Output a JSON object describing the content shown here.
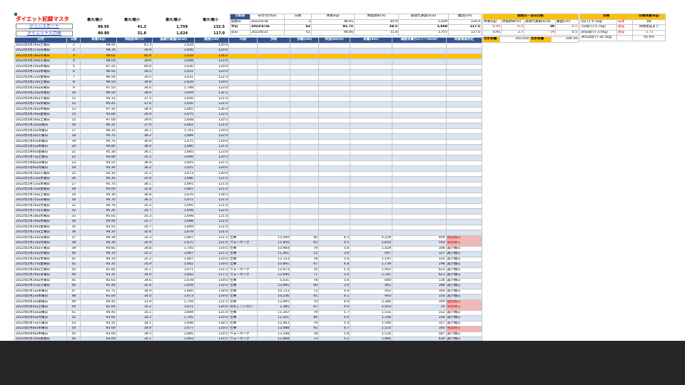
{
  "app": {
    "title": "ダイエット記録マスタ"
  },
  "nav": {
    "dashboard": "ダッシュボード",
    "input": "ダイエット入力表"
  },
  "top_headers": {
    "h1": "最大/最小",
    "h2": "最大/最小",
    "h3": "最大/最小",
    "h4": "最大/最小"
  },
  "summary_rows": [
    {
      "a": "98.95",
      "b": "41.3",
      "c": "1,759",
      "d": "132.5"
    },
    {
      "a": "90.80",
      "b": "31.8",
      "c": "1,624",
      "d": "117.0"
    }
  ],
  "compare": {
    "title": "比較表",
    "headers": [
      "日付(年月日)",
      "日数",
      "体重(kg)",
      "体脂肪率(%)",
      "基礎代謝量(kcal)",
      "腹囲(cm)"
    ],
    "rows": [
      {
        "label": "開始日",
        "date": "2022/4/18",
        "days": "3",
        "w": "98.65",
        "f": "40.9",
        "b": "1,629",
        "g": "124.0"
      },
      {
        "label": "今日",
        "date": "2022/6/16",
        "days": "62",
        "w": "91.75",
        "f": "34.5",
        "b": "1,668",
        "g": "117.5"
      },
      {
        "label": "前日",
        "date": "2022/6/15",
        "days": "61",
        "w": "90.80",
        "f": "31.8",
        "b": "1,707",
        "g": "117.0"
      }
    ]
  },
  "change": {
    "title": "開始日・前日比較",
    "headers": [
      "体重(kg)",
      "体脂肪率(%)",
      "基礎代謝量(kcal)",
      "腹囲(cm)"
    ],
    "rows": [
      [
        "-6.90",
        "-6.4",
        "39",
        "-6.5"
      ],
      [
        "0.95",
        "2.7",
        "-39",
        "0.5"
      ]
    ]
  },
  "goals": {
    "title": "目標",
    "status_title": "目標体重(kg)",
    "rows": [
      {
        "goal": "1日で[-0.1kg]",
        "status": "未達",
        "val": "88"
      },
      {
        "goal": "7日間で[-0.7kg]",
        "status": "達成",
        "val": "目標達成まで"
      },
      {
        "goal": "30日間で[-3.0kg]",
        "status": "達成",
        "val": "-3.75"
      },
      {
        "goal": "365日間で[-36.5kg]",
        "status": "",
        "val": "95.9%"
      }
    ]
  },
  "totals": {
    "label1": "合計距離",
    "v1": "292,058",
    "label2": "合計距離",
    "v2": "206.59"
  },
  "table": {
    "headers": [
      "日付",
      "日数",
      "体重(kg)",
      "体脂肪率(%)",
      "基礎代謝量(kcal)",
      "腹囲(cm)",
      "内容",
      "歩数",
      "歩幅(cm)",
      "時速(km/h)",
      "距離(km)",
      "運動消費カロリー(kcal)",
      "体重増減判定"
    ],
    "rows": [
      [
        "2022年4月16日土曜日",
        "1",
        "98.95",
        "41.3",
        "1,624",
        "120.0",
        "",
        "",
        "",
        "",
        "",
        "",
        ""
      ],
      [
        "2022年4月17日日曜日",
        "2",
        "98.35",
        "39.9",
        "1,646",
        "120.0",
        "",
        "",
        "",
        "",
        "",
        "",
        ""
      ],
      [
        "2022年4月18日月曜日",
        "3",
        "98.65",
        "40.9",
        "1,629",
        "124.0",
        "",
        "",
        "",
        "",
        "",
        "",
        ""
      ],
      [
        "2022年4月19日火曜日",
        "4",
        "98.00",
        "39.6",
        "1,648",
        "123.0",
        "",
        "",
        "",
        "",
        "",
        "",
        ""
      ],
      [
        "2022年4月20日水曜日",
        "5",
        "97.25",
        "40.0",
        "1,630",
        "120.0",
        "",
        "",
        "",
        "",
        "",
        "",
        ""
      ],
      [
        "2022年4月21日木曜日",
        "6",
        "96.50",
        "39.5",
        "1,631",
        "123.0",
        "",
        "",
        "",
        "",
        "",
        "",
        ""
      ],
      [
        "2022年4月22日金曜日",
        "7",
        "96.50",
        "39.5",
        "1,631",
        "122.5",
        "",
        "",
        "",
        "",
        "",
        "",
        ""
      ],
      [
        "2022年4月23日土曜日",
        "8",
        "96.50",
        "39.8",
        "1,628",
        "119.0",
        "",
        "",
        "",
        "",
        "",
        "",
        ""
      ],
      [
        "2022年4月24日日曜日",
        "9",
        "97.55",
        "34.6",
        "1,748",
        "123.0",
        "",
        "",
        "",
        "",
        "",
        "",
        ""
      ],
      [
        "2022年4月25日月曜日",
        "10",
        "96.50",
        "38.6",
        "1,649",
        "132.5",
        "",
        "",
        "",
        "",
        "",
        "",
        ""
      ],
      [
        "2022年4月26日火曜日",
        "11",
        "95.15",
        "37.5",
        "1,656",
        "121.0",
        "",
        "",
        "",
        "",
        "",
        "",
        ""
      ],
      [
        "2022年4月27日水曜日",
        "12",
        "95.45",
        "37.6",
        "1,656",
        "121.0",
        "",
        "",
        "",
        "",
        "",
        "",
        ""
      ],
      [
        "2022年4月28日木曜日",
        "13",
        "97.35",
        "38.4",
        "1,665",
        "126.0",
        "",
        "",
        "",
        "",
        "",
        "",
        ""
      ],
      [
        "2022年4月29日金曜日",
        "14",
        "95.80",
        "36.9",
        "1,675",
        "122.0",
        "",
        "",
        "",
        "",
        "",
        "",
        ""
      ],
      [
        "2022年4月30日土曜日",
        "15",
        "97.00",
        "39.0",
        "1,648",
        "120.5",
        "",
        "",
        "",
        "",
        "",
        "",
        ""
      ],
      [
        "2022年5月1日日曜日",
        "16",
        "96.35",
        "37.9",
        "1,662",
        "121.0",
        "",
        "",
        "",
        "",
        "",
        "",
        ""
      ],
      [
        "2022年5月2日月曜日",
        "17",
        "96.35",
        "34.1",
        "1,741",
        "119.0",
        "",
        "",
        "",
        "",
        "",
        "",
        ""
      ],
      [
        "2022年5月3日火曜日",
        "18",
        "95.75",
        "36.2",
        "1,689",
        "122.0",
        "",
        "",
        "",
        "",
        "",
        "",
        ""
      ],
      [
        "2022年5月4日水曜日",
        "19",
        "95.75",
        "36.9",
        "1,675",
        "119.0",
        "",
        "",
        "",
        "",
        "",
        "",
        ""
      ],
      [
        "2022年5月5日木曜日",
        "20",
        "94.80",
        "36.0",
        "1,680",
        "121.0",
        "",
        "",
        "",
        "",
        "",
        "",
        ""
      ],
      [
        "2022年5月6日金曜日",
        "21",
        "95.30",
        "36.1",
        "1,685",
        "123.0",
        "",
        "",
        "",
        "",
        "",
        "",
        ""
      ],
      [
        "2022年5月7日土曜日",
        "22",
        "94.80",
        "35.5",
        "1,690",
        "120.5",
        "",
        "",
        "",
        "",
        "",
        "",
        ""
      ],
      [
        "2022年5月8日日曜日",
        "23",
        "93.55",
        "36.9",
        "1,645",
        "121.5",
        "",
        "",
        "",
        "",
        "",
        "",
        ""
      ],
      [
        "2022年5月9日月曜日",
        "24",
        "93.30",
        "36.2",
        "1,655",
        "120.0",
        "",
        "",
        "",
        "",
        "",
        "",
        ""
      ],
      [
        "2022年5月10日火曜日",
        "25",
        "93.10",
        "35.2",
        "1,673",
        "120.0",
        "",
        "",
        "",
        "",
        "",
        "",
        ""
      ],
      [
        "2022年5月11日水曜日",
        "26",
        "94.35",
        "35.4",
        "1,686",
        "121.0",
        "",
        "",
        "",
        "",
        "",
        "",
        ""
      ],
      [
        "2022年5月12日木曜日",
        "27",
        "95.75",
        "36.1",
        "1,691",
        "121.0",
        "",
        "",
        "",
        "",
        "",
        "",
        ""
      ],
      [
        "2022年5月13日金曜日",
        "28",
        "95.00",
        "35.8",
        "1,687",
        "121.0",
        "",
        "",
        "",
        "",
        "",
        "",
        ""
      ],
      [
        "2022年5月14日土曜日",
        "29",
        "95.30",
        "36.8",
        "1,670",
        "118.5",
        "",
        "",
        "",
        "",
        "",
        "",
        ""
      ],
      [
        "2022年5月15日日曜日",
        "30",
        "94.70",
        "36.3",
        "1,672",
        "121.0",
        "",
        "",
        "",
        "",
        "",
        "",
        ""
      ],
      [
        "2022年5月16日月曜日",
        "31",
        "94.70",
        "35.2",
        "1,695",
        "121.0",
        "",
        "",
        "",
        "",
        "",
        "",
        ""
      ],
      [
        "2022年5月17日火曜日",
        "32",
        "95.35",
        "35.7",
        "1,694",
        "122.0",
        "",
        "",
        "",
        "",
        "",
        "",
        ""
      ],
      [
        "2022年5月18日水曜日",
        "33",
        "95.05",
        "35.3",
        "1,698",
        "121.0",
        "",
        "",
        "",
        "",
        "",
        "",
        ""
      ],
      [
        "2022年5月19日木曜日",
        "34",
        "94.90",
        "35.7",
        "1,688",
        "122.0",
        "",
        "",
        "",
        "",
        "",
        "",
        ""
      ],
      [
        "2022年5月20日金曜日",
        "35",
        "93.55",
        "35.7",
        "1,669",
        "121.0",
        "",
        "",
        "",
        "",
        "",
        "",
        ""
      ],
      [
        "2022年5月21日土曜日",
        "36",
        "94.10",
        "35.6",
        "1,678",
        "121.0",
        "",
        "",
        "",
        "",
        "",
        "",
        ""
      ],
      [
        "2022年5月22日日曜日",
        "37",
        "94.30",
        "35.3",
        "1,687",
        "121.5",
        "仕事",
        "15,500",
        "60",
        "4.5",
        "4,159",
        "409",
        "増加傾向"
      ],
      [
        "2022年5月23日月曜日",
        "38",
        "94.30",
        "35.9",
        "1,675",
        "121.0",
        "ウォーキング",
        "11,850",
        "65",
        "4.5",
        "2,833",
        "593",
        "増加傾向"
      ],
      [
        "2022年5月24日火曜日",
        "39",
        "94.85",
        "34.8",
        "1,705",
        "119.5",
        "仕事",
        "10,964",
        "79",
        "5.6",
        "1,429",
        "308",
        "減少傾向"
      ],
      [
        "2022年5月25日水曜日",
        "40",
        "94.10",
        "35.2",
        "1,687",
        "121.5",
        "仕事",
        "11,461",
        "52",
        "3.6",
        "947",
        "327",
        "減少傾向"
      ],
      [
        "2022年5月26日木曜日",
        "41",
        "94.10",
        "35.2",
        "1,687",
        "120.0",
        "仕事",
        "12,153",
        "78",
        "5.6",
        "1,197",
        "335",
        "減少傾向"
      ],
      [
        "2022年5月27日金曜日",
        "42",
        "93.35",
        "35.9",
        "1,662",
        "119.0",
        "仕事",
        "10,891",
        "67",
        "4.8",
        "1,739",
        "298",
        "減少傾向"
      ],
      [
        "2022年5月28日土曜日",
        "43",
        "92.85",
        "35.1",
        "1,671",
        "121.5",
        "ウォーキング",
        "12,973",
        "76",
        "5.4",
        "1,952",
        "623",
        "減少傾向"
      ],
      [
        "2022年5月29日日曜日",
        "44",
        "93.35",
        "34.9",
        "1,682",
        "117.5",
        "ウォーキング",
        "12,690",
        "77",
        "5.4",
        "1,781",
        "621",
        "減少傾向"
      ],
      [
        "2022年5月30日月曜日",
        "45",
        "92.65",
        "34.6",
        "1,678",
        "119.0",
        "仕事",
        "5,031",
        "78",
        "5.6",
        "840",
        "136",
        "減少傾向"
      ],
      [
        "2022年5月31日火曜日",
        "46",
        "92.40",
        "35.4",
        "1,659",
        "119.0",
        "仕事",
        "12,995",
        "60",
        "3.9",
        "461",
        "388",
        "減少傾向"
      ],
      [
        "2022年6月1日水曜日",
        "47",
        "91.75",
        "34.9",
        "1,660",
        "118.0",
        "仕事",
        "10,723",
        "72",
        "4.9",
        "402",
        "304",
        "減少傾向"
      ],
      [
        "2022年6月2日木曜日",
        "48",
        "92.00",
        "34.4",
        "1,673",
        "119.0",
        "仕事",
        "10,236",
        "65",
        "4.1",
        "943",
        "314",
        "減少傾向"
      ],
      [
        "2022年6月3日金曜日",
        "49",
        "94.45",
        "31.9",
        "1,759",
        "121.5",
        "仕事",
        "12,005",
        "70",
        "4.9",
        "3,366",
        "340",
        "増加傾向"
      ],
      [
        "2022年6月4日土曜日",
        "50",
        "92.95",
        "35.2",
        "1,671",
        "120.0",
        "何もしていない",
        "1,385",
        "67",
        "4.6",
        "3,503",
        "20",
        "増加傾向"
      ],
      [
        "2022年6月5日日曜日",
        "51",
        "94.45",
        "35.1",
        "1,694",
        "121.0",
        "仕事",
        "11,347",
        "79",
        "5.7",
        "1,531",
        "312",
        "減少傾向"
      ],
      [
        "2022年6月6日月曜日",
        "52",
        "93.95",
        "34.2",
        "1,705",
        "120.0",
        "仕事",
        "11,451",
        "84",
        "6.0",
        "1,336",
        "316",
        "減少傾向"
      ],
      [
        "2022年6月7日火曜日",
        "53",
        "93.35",
        "34.1",
        "1,698",
        "118.5",
        "仕事",
        "12,463",
        "79",
        "5.4",
        "1,590",
        "357",
        "減少傾向"
      ],
      [
        "2022年6月8日水曜日",
        "54",
        "93.00",
        "34.9",
        "1,677",
        "120.0",
        "仕事",
        "12,688",
        "92",
        "6.7",
        "2,514",
        "340",
        "増加傾向"
      ],
      [
        "2022年6月9日木曜日",
        "55",
        "93.00",
        "34.5",
        "1,685",
        "119.5",
        "ウォーキング",
        "13,108",
        "78",
        "5.8",
        "1,534",
        "587",
        "減少傾向"
      ],
      [
        "2022年6月10日金曜日",
        "56",
        "93.00",
        "34.1",
        "1,693",
        "119.5",
        "ウォーキング",
        "12,868",
        "73",
        "5.1",
        "1,966",
        "630",
        "減少傾向"
      ],
      [
        "2022年6月11日土曜日",
        "57",
        "93.40",
        "33.1",
        "1,719",
        "118.5",
        "仕事",
        "3,801",
        "63",
        "4.1",
        "1,988",
        "115",
        "増加傾向"
      ],
      [
        "2022年6月12日日曜日",
        "58",
        "92.55",
        "33.9",
        "1,691",
        "119.0",
        "仕事",
        "12,316",
        "63",
        "3.6",
        "709",
        "419",
        "減少傾向"
      ],
      [
        "2022年6月13日月曜日",
        "59",
        "91.30",
        "34.5",
        "1,661",
        "119.0",
        "仕事",
        "12,834",
        "68",
        "4.4",
        "608",
        "380",
        "減少傾向"
      ],
      [
        "2022年6月14日火曜日",
        "60",
        "90.90",
        "34.4",
        "1,658",
        "119.0",
        "仕事",
        "11,811",
        "50",
        "3.0",
        "1,002",
        "376",
        "減少傾向"
      ],
      [
        "2022年6月15日水曜日",
        "61",
        "90.80",
        "31.8",
        "1,707",
        "117.0",
        "仕事",
        "15,773",
        "68",
        "4.8",
        "4,347",
        "426",
        "増加傾向"
      ],
      [
        "2022年6月16日木曜日",
        "62",
        "91.75",
        "34.5",
        "1,668",
        "117.5",
        "ウォーキング",
        "11,703",
        "77",
        "5.4",
        "589",
        "563",
        "減少傾向"
      ]
    ]
  }
}
